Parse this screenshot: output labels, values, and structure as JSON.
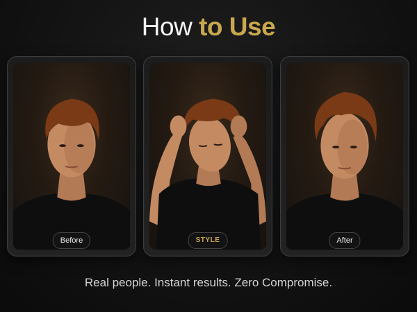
{
  "heading": {
    "plain": "How",
    "accent": "to Use"
  },
  "cards": [
    {
      "label": "Before"
    },
    {
      "label": "STYLE"
    },
    {
      "label": "After"
    }
  ],
  "tagline": "Real people. Instant results. Zero Compromise.",
  "colors": {
    "accent": "#c9a84c",
    "background": "#121212",
    "text": "#f4f4f4"
  }
}
